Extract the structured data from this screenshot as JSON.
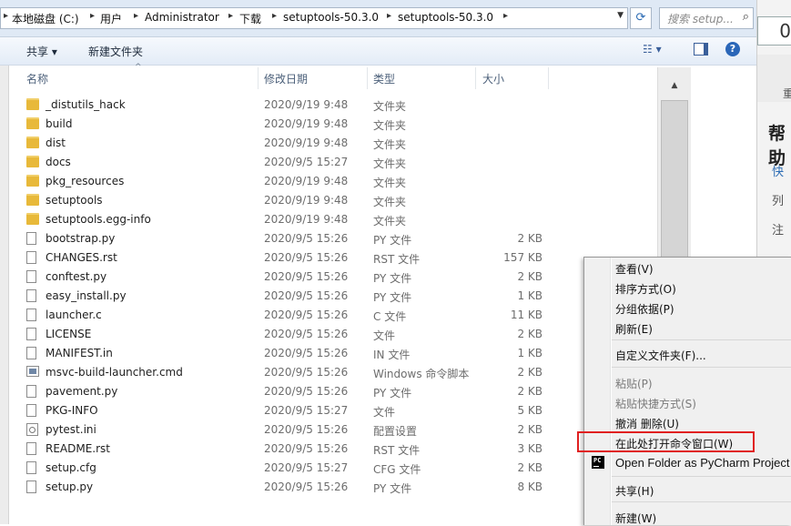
{
  "addressbar": {
    "segments": [
      "本地磁盘 (C:)",
      "用户",
      "Administrator",
      "下载",
      "setuptools-50.3.0",
      "setuptools-50.3.0"
    ],
    "search_placeholder": "搜索 setup..."
  },
  "toolbar": {
    "share": "共享 ▾",
    "new_folder": "新建文件夹"
  },
  "columns": {
    "name": "名称",
    "date": "修改日期",
    "type": "类型",
    "size": "大小"
  },
  "files": [
    {
      "name": "_distutils_hack",
      "date": "2020/9/19 9:48",
      "type": "文件夹",
      "size": "",
      "icon": "folder"
    },
    {
      "name": "build",
      "date": "2020/9/19 9:48",
      "type": "文件夹",
      "size": "",
      "icon": "folder"
    },
    {
      "name": "dist",
      "date": "2020/9/19 9:48",
      "type": "文件夹",
      "size": "",
      "icon": "folder"
    },
    {
      "name": "docs",
      "date": "2020/9/5 15:27",
      "type": "文件夹",
      "size": "",
      "icon": "folder"
    },
    {
      "name": "pkg_resources",
      "date": "2020/9/19 9:48",
      "type": "文件夹",
      "size": "",
      "icon": "folder"
    },
    {
      "name": "setuptools",
      "date": "2020/9/19 9:48",
      "type": "文件夹",
      "size": "",
      "icon": "folder"
    },
    {
      "name": "setuptools.egg-info",
      "date": "2020/9/19 9:48",
      "type": "文件夹",
      "size": "",
      "icon": "folder"
    },
    {
      "name": "bootstrap.py",
      "date": "2020/9/5 15:26",
      "type": "PY 文件",
      "size": "2 KB",
      "icon": "doc"
    },
    {
      "name": "CHANGES.rst",
      "date": "2020/9/5 15:26",
      "type": "RST 文件",
      "size": "157 KB",
      "icon": "doc"
    },
    {
      "name": "conftest.py",
      "date": "2020/9/5 15:26",
      "type": "PY 文件",
      "size": "2 KB",
      "icon": "doc"
    },
    {
      "name": "easy_install.py",
      "date": "2020/9/5 15:26",
      "type": "PY 文件",
      "size": "1 KB",
      "icon": "doc"
    },
    {
      "name": "launcher.c",
      "date": "2020/9/5 15:26",
      "type": "C 文件",
      "size": "11 KB",
      "icon": "doc"
    },
    {
      "name": "LICENSE",
      "date": "2020/9/5 15:26",
      "type": "文件",
      "size": "2 KB",
      "icon": "doc"
    },
    {
      "name": "MANIFEST.in",
      "date": "2020/9/5 15:26",
      "type": "IN 文件",
      "size": "1 KB",
      "icon": "doc"
    },
    {
      "name": "msvc-build-launcher.cmd",
      "date": "2020/9/5 15:26",
      "type": "Windows 命令脚本",
      "size": "2 KB",
      "icon": "cmd"
    },
    {
      "name": "pavement.py",
      "date": "2020/9/5 15:26",
      "type": "PY 文件",
      "size": "2 KB",
      "icon": "doc"
    },
    {
      "name": "PKG-INFO",
      "date": "2020/9/5 15:27",
      "type": "文件",
      "size": "5 KB",
      "icon": "doc"
    },
    {
      "name": "pytest.ini",
      "date": "2020/9/5 15:26",
      "type": "配置设置",
      "size": "2 KB",
      "icon": "gear"
    },
    {
      "name": "README.rst",
      "date": "2020/9/5 15:26",
      "type": "RST 文件",
      "size": "3 KB",
      "icon": "doc"
    },
    {
      "name": "setup.cfg",
      "date": "2020/9/5 15:27",
      "type": "CFG 文件",
      "size": "2 KB",
      "icon": "doc"
    },
    {
      "name": "setup.py",
      "date": "2020/9/5 15:26",
      "type": "PY 文件",
      "size": "8 KB",
      "icon": "doc"
    }
  ],
  "context_menu": {
    "view": "查看(V)",
    "sort": "排序方式(O)",
    "group": "分组依据(P)",
    "refresh": "刷新(E)",
    "customize": "自定义文件夹(F)...",
    "paste": "粘贴(P)",
    "paste_shortcut": "粘贴快捷方式(S)",
    "undo": "撤消 删除(U)",
    "open_cmd": "在此处打开命令窗口(W)",
    "pycharm": "Open Folder as PyCharm Project",
    "share": "共享(H)",
    "new": "新建(W)"
  },
  "background_window": {
    "value": "0",
    "header": "帮助",
    "items": [
      "快",
      "列",
      "注"
    ],
    "top_char": "重"
  },
  "colors": {
    "highlight_box": "#e02020",
    "accent": "#2b67b8"
  }
}
